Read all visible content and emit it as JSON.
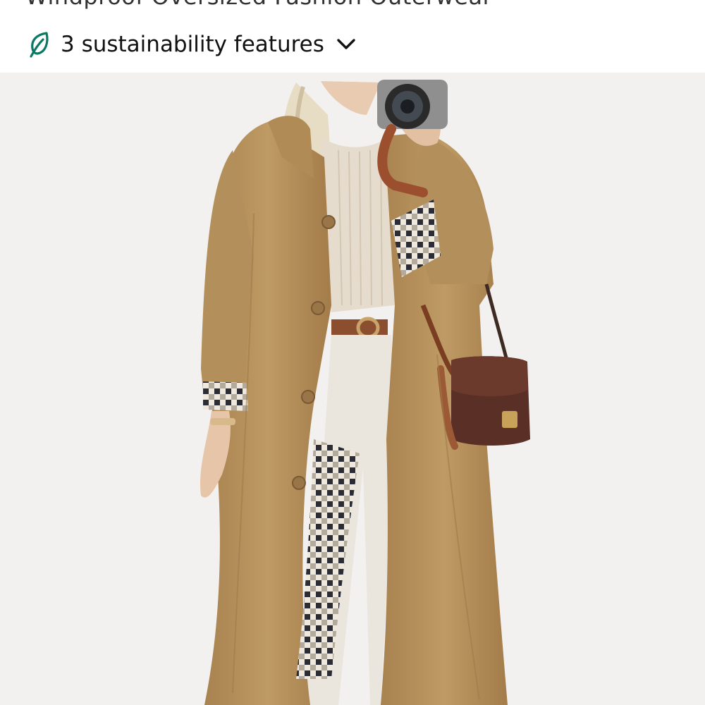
{
  "product": {
    "title_partial": "Windproof Oversized Fashion Outerwear",
    "image_alt": "Woman wearing a long camel trench coat with checked lining, holding a camera and a brown crossbody bag"
  },
  "sustainability": {
    "label": "3 sustainability features",
    "icon": "leaf-icon",
    "expand_icon": "chevron-down-icon"
  },
  "colors": {
    "leaf_accent": "#0b7a64",
    "coat": "#b89560",
    "image_background": "#f2f1f0"
  }
}
